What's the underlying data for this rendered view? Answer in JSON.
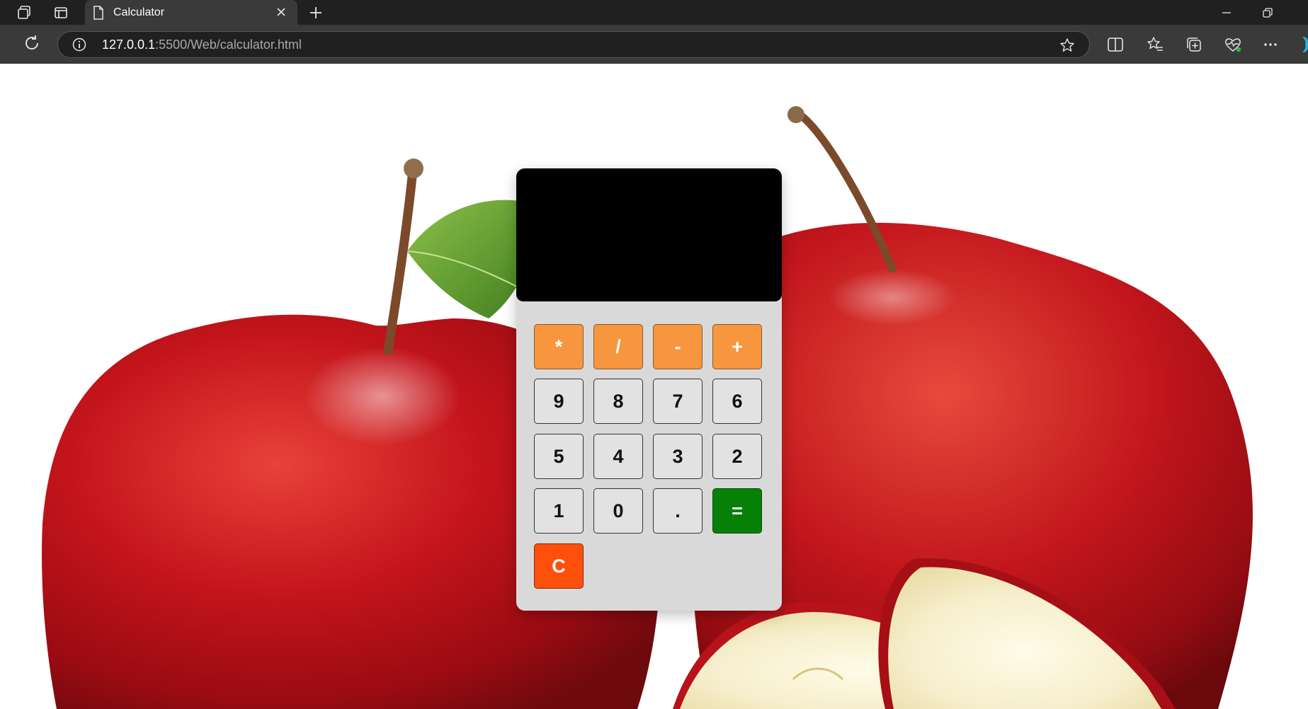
{
  "browser": {
    "tab_title": "Calculator",
    "url_host": "127.0.0.1",
    "url_rest": ":5500/Web/calculator.html",
    "icons": {
      "workspaces": "workspaces-icon",
      "tab_actions": "tab-actions-icon",
      "page": "page-icon",
      "close_tab": "close-icon",
      "new_tab": "plus-icon",
      "minimize": "minimize-icon",
      "restore": "restore-icon",
      "refresh": "refresh-icon",
      "site_info": "info-icon",
      "favorite": "star-icon",
      "split_screen": "split-screen-icon",
      "favorites": "favorites-icon",
      "collections": "collections-icon",
      "browser_essentials": "heart-pulse-icon",
      "more": "more-icon"
    }
  },
  "calculator": {
    "display_value": "",
    "keys": {
      "multiply": "*",
      "divide": "/",
      "subtract": "-",
      "add": "+",
      "nine": "9",
      "eight": "8",
      "seven": "7",
      "six": "6",
      "five": "5",
      "four": "4",
      "three": "3",
      "two": "2",
      "one": "1",
      "zero": "0",
      "decimal": ".",
      "equals": "=",
      "clear": "C"
    },
    "colors": {
      "operator": "#f7963f",
      "equals": "#078007",
      "clear": "#ff4f0c",
      "digit": "#e2e2e2",
      "display": "#000000",
      "body": "#d9d9d9"
    }
  },
  "background": {
    "image": "red apples with leaf and sliced apple half"
  }
}
